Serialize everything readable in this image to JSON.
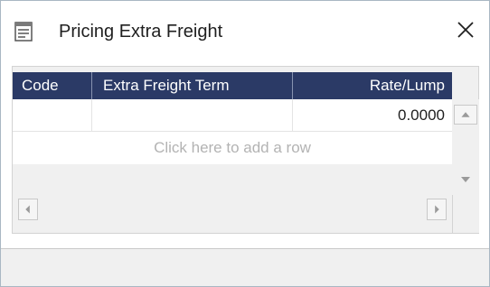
{
  "window": {
    "title": "Pricing Extra Freight",
    "title_icon": "document-list-icon",
    "close_icon": "close-x-icon"
  },
  "grid": {
    "columns": [
      "Code",
      "Extra Freight Term",
      "Rate/Lump"
    ],
    "rows": [
      {
        "code": "",
        "term": "",
        "rate": "0.0000"
      }
    ],
    "add_row_text": "Click here to add a row",
    "header_color": "#2b3a66"
  },
  "scrollbars": {
    "up_icon": "scroll-up-arrow-icon",
    "down_icon": "scroll-down-arrow-icon",
    "left_icon": "scroll-left-arrow-icon",
    "right_icon": "scroll-right-arrow-icon"
  }
}
